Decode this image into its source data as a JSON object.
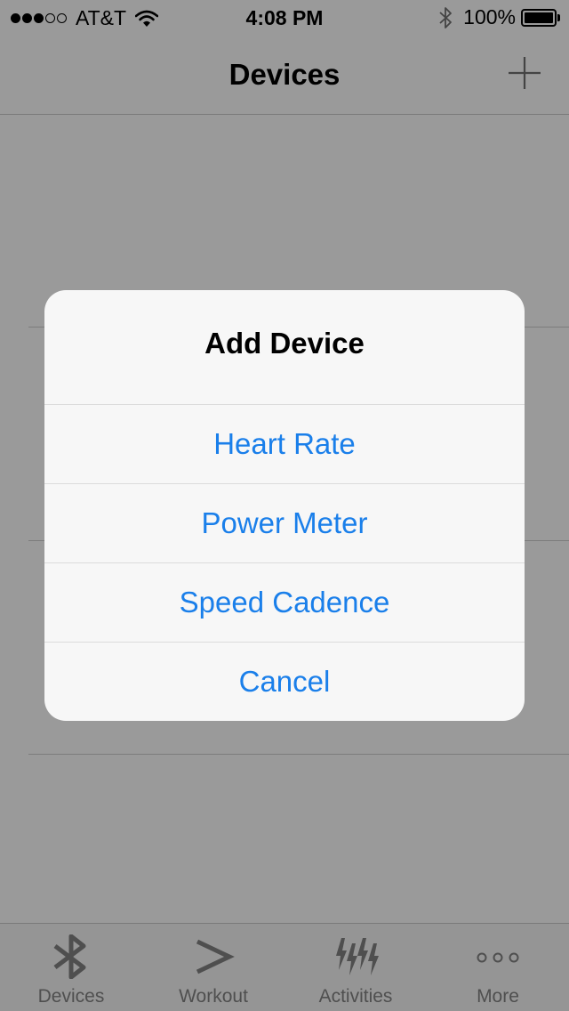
{
  "status_bar": {
    "carrier": "AT&T",
    "time": "4:08 PM",
    "battery": "100%",
    "signal_bars_filled": 3,
    "signal_bars_total": 5
  },
  "nav": {
    "title": "Devices",
    "add_icon": "plus-icon"
  },
  "alert": {
    "title": "Add Device",
    "actions": [
      {
        "label": "Heart Rate"
      },
      {
        "label": "Power Meter"
      },
      {
        "label": "Speed Cadence"
      },
      {
        "label": "Cancel"
      }
    ],
    "action_color": "#1a7fea"
  },
  "tabs": [
    {
      "label": "Devices",
      "icon": "bluetooth-icon"
    },
    {
      "label": "Workout",
      "icon": "chevron-right-icon"
    },
    {
      "label": "Activities",
      "icon": "lightning-icon"
    },
    {
      "label": "More",
      "icon": "more-icon"
    }
  ],
  "colors": {
    "dim_background": "#9a9a9a",
    "alert_background": "#f7f7f7",
    "tab_icon": "#4f4f4f"
  }
}
